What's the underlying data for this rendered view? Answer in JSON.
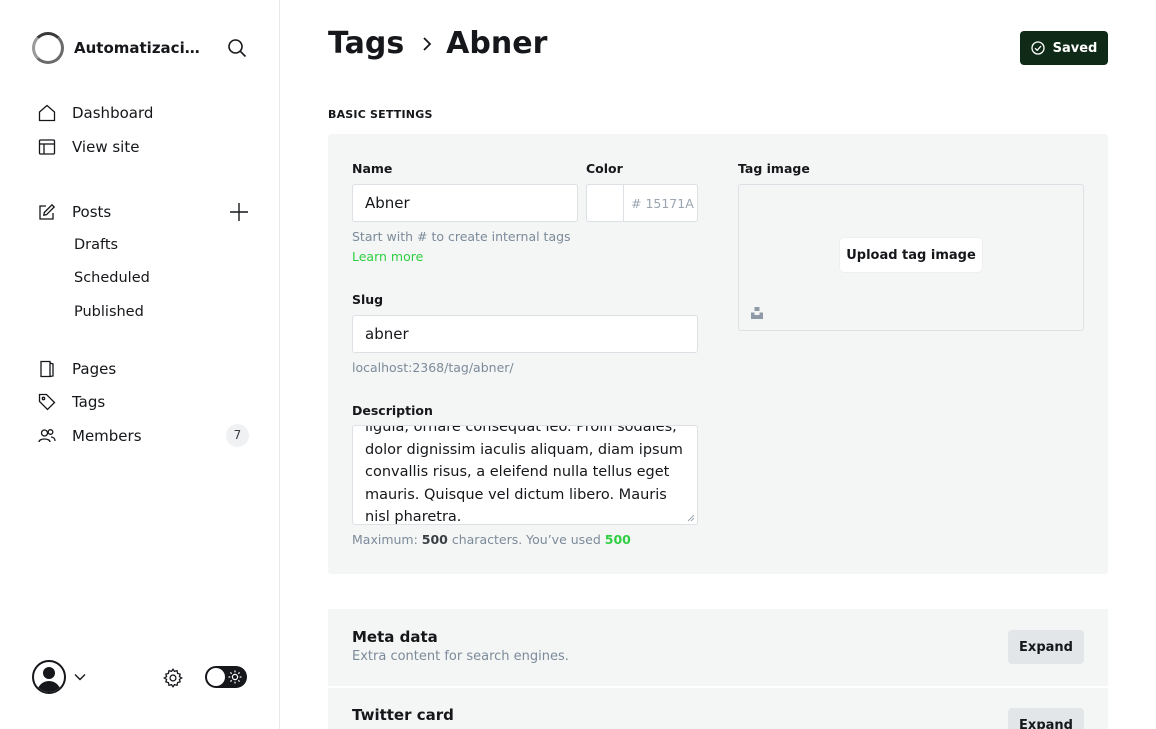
{
  "sidebar": {
    "site_name": "Automatizaciones",
    "nav": {
      "dashboard": "Dashboard",
      "view_site": "View site",
      "posts": "Posts",
      "drafts": "Drafts",
      "scheduled": "Scheduled",
      "published": "Published",
      "pages": "Pages",
      "tags": "Tags",
      "members": "Members",
      "members_count": "7"
    }
  },
  "header": {
    "crumb_parent": "Tags",
    "crumb_current": "Abner",
    "saved_label": "Saved"
  },
  "basic": {
    "section_title": "BASIC SETTINGS",
    "name_label": "Name",
    "name_value": "Abner",
    "color_label": "Color",
    "color_placeholder": "# 15171A",
    "name_hint": "Start with # to create internal tags",
    "learn_more": "Learn more",
    "slug_label": "Slug",
    "slug_value": "abner",
    "slug_url": "localhost:2368/tag/abner/",
    "description_label": "Description",
    "description_text": "ligula, ornare consequat leo. Proin sodales, dolor dignissim iaculis aliquam, diam ipsum convallis risus, a eleifend nulla tellus eget mauris. Quisque vel dictum libero. Mauris nisl pharetra.",
    "counter_prefix": "Maximum: ",
    "counter_max": "500",
    "counter_mid": " characters. You’ve used ",
    "counter_used": "500",
    "tag_image_label": "Tag image",
    "upload_label": "Upload tag image"
  },
  "panels": {
    "meta_title": "Meta data",
    "meta_sub": "Extra content for search engines.",
    "meta_expand": "Expand",
    "twitter_title": "Twitter card",
    "twitter_expand": "Expand"
  },
  "colors": {
    "accent_green": "#30cf43",
    "saved_bg": "#0f2a16",
    "panel_bg": "#f4f5f5"
  }
}
